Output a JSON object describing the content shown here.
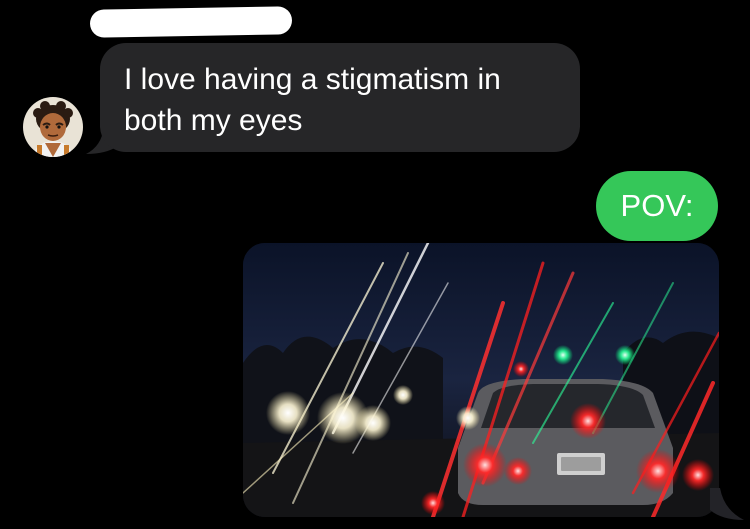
{
  "conversation": {
    "incoming": {
      "avatar_icon": "cartoon-avatar-icon",
      "text_line_1": "I love having a stigmatism in",
      "text_line_2": "both my eyes",
      "bubble_color": "#262628"
    },
    "outgoing_text": {
      "text": "POV:",
      "bubble_color": "#35c759"
    },
    "outgoing_photo": {
      "alt": "Night traffic with long light streaks from headlights and tail lights"
    }
  }
}
